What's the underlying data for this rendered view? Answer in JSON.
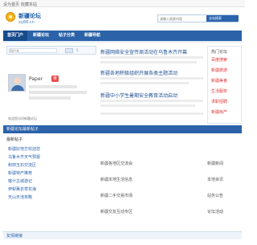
{
  "topbar": {
    "left_links": [
      "设为首页",
      "收藏本站"
    ]
  },
  "logo": {
    "name": "新疆论坛",
    "domain": "xy86.cn"
  },
  "search": {
    "placeholder": "请输入搜索内容",
    "scope": "全站搜索"
  },
  "nav": {
    "items": [
      "首页门户",
      "新疆论坛",
      "帖子分类",
      "新疆导航"
    ]
  },
  "login": {
    "placeholder": "用户名",
    "count": "5"
  },
  "profile": {
    "name": "Paper",
    "badge": "亲",
    "link": "欢迎您访问新疆论坛"
  },
  "main": {
    "headlines": [
      "新疆网络安全宣传周活动在乌鲁木齐开幕",
      "新疆各地积极组织开展各类主题活动",
      "新疆中小学生暑期安全教育活动启动"
    ]
  },
  "sidebar": {
    "head": "热门论坛",
    "items": [
      "百度搜索",
      "新疆旅游",
      "新疆美食",
      "生活服务",
      "求职招聘",
      "新疆房产"
    ]
  },
  "section": {
    "title": "新疆论坛最新帖子"
  },
  "left_list": {
    "label": "最新帖子",
    "items": [
      "新疆好地方欢迎您",
      "乌鲁木齐天气预报",
      "和田玉石交流区",
      "新疆特产推荐",
      "喀什古城游记",
      "伊犁薰衣草花海",
      "天山天池攻略"
    ]
  },
  "mid_list": {
    "items": [
      "新疆各地区交流会",
      "新疆本地生活信息",
      "新疆二手交易市场",
      "新疆交友互动专区"
    ]
  },
  "right_list": {
    "items": [
      "新疆新闻",
      "本地资讯",
      "站务公告",
      "论坛活动"
    ]
  },
  "footer": {
    "title": "友情链接"
  }
}
